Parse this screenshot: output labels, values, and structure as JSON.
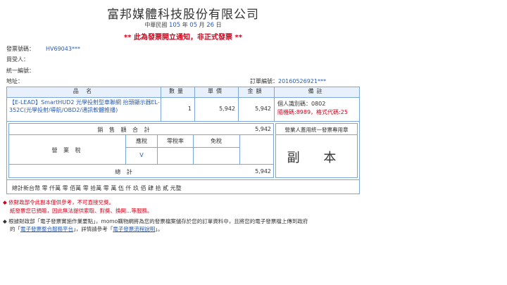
{
  "header": {
    "company": "富邦媒體科技股份有限公司",
    "era": "中華民國",
    "year": "105",
    "year_unit": "年",
    "month": "05",
    "month_unit": "月",
    "day": "26",
    "day_unit": "日",
    "notice": "** 此為發票開立通知，非正式發票 **"
  },
  "meta": {
    "invoice_no_label": "發票號碼：",
    "invoice_no": "HV69043***",
    "buyer_label": "買受人：",
    "tax_id_label": "統一編號：",
    "address_label": "地址：",
    "order_label": "訂單編號：",
    "order_no": "20160526921***"
  },
  "table": {
    "col_name": "品 名",
    "col_qty": "數量",
    "col_price": "單價",
    "col_amount": "金額",
    "col_note": "備註",
    "item_name": "【E-LEAD】SmartHUD2 光學投射型車聯網 抬頭顯示器EL-352C(光學投射/導航/OBD2/通訊軟體推播)",
    "item_qty": "1",
    "item_price": "5,942",
    "item_amount": "5,942",
    "note_line1": "個人識別碼：0802",
    "note_line2": "隨機碼:8989，格式代碼:25",
    "subtotal_label": "銷 售 額 合 計",
    "subtotal": "5,942",
    "business_tax_label": "營 業 稅",
    "taxable_label": "應稅",
    "zero_rate_label": "零稅率",
    "exempt_label": "免稅",
    "taxable_mark": "V",
    "total_label": "總 計",
    "total": "5,942",
    "stamp_title": "營業人蓋用統一發票專用章",
    "copy_mark": "副 本",
    "total_words": "總計新台幣 零 仟萬 零 佰萬 零 拾萬 零 萬 伍 仟 玖 佰 肆 拾 貳 元整"
  },
  "footer": {
    "line1": "◆ 依財政部令此副本僅供參考，不可直接兌獎。",
    "line2": "紙發票您已捐贈，因此無法提供索取、對獎、換開…等服務。",
    "line3_a": "◆ 根據財政部「電子發票實施作業要點」，momo購物網將為您的發票檔案儲存於您的訂單資料中，且將您的電子發票檔上傳到政府",
    "line4_a": "的「",
    "line4_link1": "電子發票整合服務平台",
    "line4_b": "」，詳情請參考「",
    "line4_link2": "電子發票流程說明",
    "line4_c": "」。"
  }
}
